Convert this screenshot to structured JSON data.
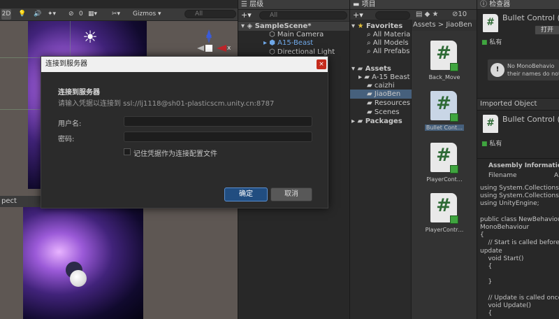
{
  "scene": {
    "toolbar": {
      "mode_2d": "2D",
      "hidden_count": "0",
      "gizmos": "Gizmos",
      "search_placeholder": "All"
    },
    "axis_x": "x",
    "bottom_strip": "pect"
  },
  "hierarchy": {
    "tab": "层级",
    "search_placeholder": "All",
    "items": [
      {
        "label": "SampleScene*"
      },
      {
        "label": "Main Camera"
      },
      {
        "label": "A15-Beast"
      },
      {
        "label": "Directional Light"
      }
    ]
  },
  "project": {
    "tab": "项目",
    "breadcrumb_root": "Assets",
    "breadcrumb_sep": ">",
    "breadcrumb_leaf": "JiaoBen",
    "hidden_count": "10",
    "tree": {
      "favorites": "Favorites",
      "fav_items": [
        "All Materia",
        "All Models",
        "All Prefabs"
      ],
      "assets": "Assets",
      "asset_items": [
        "A-15 Beast",
        "caizhi",
        "JiaoBen",
        "Resources",
        "Scenes"
      ],
      "packages": "Packages"
    },
    "assets": [
      {
        "label": "Back_Move",
        "glyph": "#"
      },
      {
        "label": "Bullet Cont…",
        "glyph": "#"
      },
      {
        "label": "PlayerCont…",
        "glyph": "#"
      },
      {
        "label": "PlayerContr…",
        "glyph": "#"
      }
    ]
  },
  "inspector": {
    "tab": "检查器",
    "object_name": "Bullet Control (M",
    "open_label": "打开",
    "private_label": "私有",
    "warning_line1": "No MonoBehavio",
    "warning_line2": "their names do not",
    "imported_object": "Imported Object",
    "imported_name": "Bullet Control (M",
    "imported_private": "私有",
    "assembly_info": "Assembly Information",
    "filename_label": "Filename",
    "filename_value": "A",
    "code": [
      "using System.Collections;",
      "using System.Collections.Generic;",
      "using UnityEngine;",
      "",
      "public class NewBehaviour",
      "MonoBehaviour",
      "{",
      "    // Start is called before",
      "update",
      "    void Start()",
      "    {",
      "",
      "    }",
      "",
      "    // Update is called once",
      "    void Update()",
      "    {"
    ]
  },
  "dialog": {
    "title": "连接到服务器",
    "close": "×",
    "heading": "连接到服务器",
    "description": "请输入凭据以连接到 ssl://lj1118@sh01-plasticscm.unity.cn:8787",
    "username_label": "用户名:",
    "password_label": "密码:",
    "username_value": "",
    "password_value": "",
    "remember_label": "记住凭据作为连接配置文件",
    "confirm": "确定",
    "cancel": "取消"
  },
  "colors": {
    "selection": "#46607c",
    "confirm_bg": "#214d80",
    "script_green": "#2e6a35"
  }
}
